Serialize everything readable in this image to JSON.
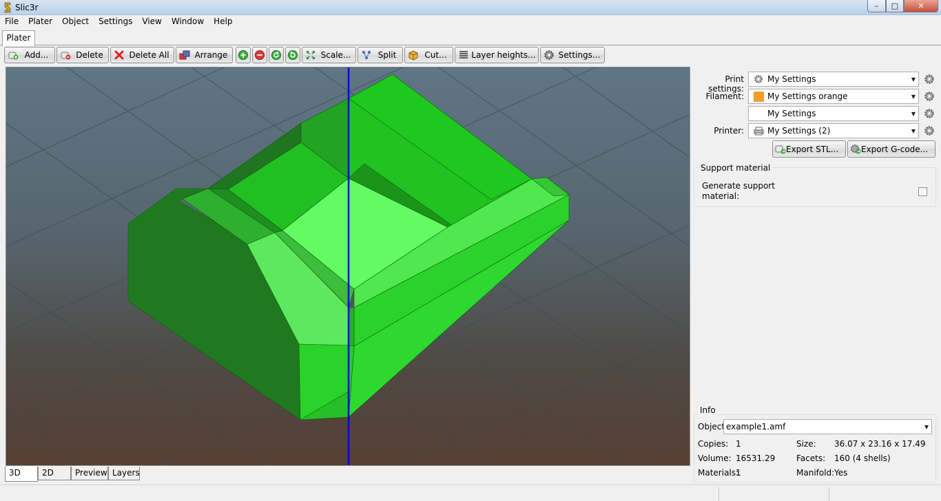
{
  "window": {
    "title": "Slic3r",
    "minimize": "–",
    "maximize": "□",
    "close": "✕"
  },
  "menu": [
    "File",
    "Plater",
    "Object",
    "Settings",
    "View",
    "Window",
    "Help"
  ],
  "tabs": {
    "plater": "Plater"
  },
  "toolbar": {
    "add": "Add...",
    "delete": "Delete",
    "delete_all": "Delete All",
    "arrange": "Arrange",
    "scale": "Scale...",
    "split": "Split",
    "cut": "Cut...",
    "layer_heights": "Layer heights...",
    "settings": "Settings..."
  },
  "view_tabs": [
    "3D",
    "2D",
    "Preview",
    "Layers"
  ],
  "presets": {
    "print_label": "Print settings:",
    "print_value": "My Settings",
    "filament_label": "Filament:",
    "filament_value": "My Settings orange",
    "filament_color": "#f29d2c",
    "filament2_value": "My Settings",
    "printer_label": "Printer:",
    "printer_value": "My Settings (2)"
  },
  "export": {
    "stl": "Export STL...",
    "gcode": "Export G-code..."
  },
  "support": {
    "group_title": "Support material",
    "generate_label_1": "Generate support",
    "generate_label_2": "material:",
    "checked": false
  },
  "info": {
    "group_title": "Info",
    "object_label": "Object:",
    "object_value": "example1.amf",
    "copies_label": "Copies:",
    "copies_value": "1",
    "size_label": "Size:",
    "size_value": "36.07 x 23.16 x 17.49",
    "volume_label": "Volume:",
    "volume_value": "16531.29",
    "facets_label": "Facets:",
    "facets_value": "160 (4 shells)",
    "materials_label": "Materials:",
    "materials_value": "1",
    "manifold_label": "Manifold:",
    "manifold_value": "Yes"
  },
  "colors": {
    "model_green": "#1ec81e",
    "cut_plane": "#0000ff"
  }
}
